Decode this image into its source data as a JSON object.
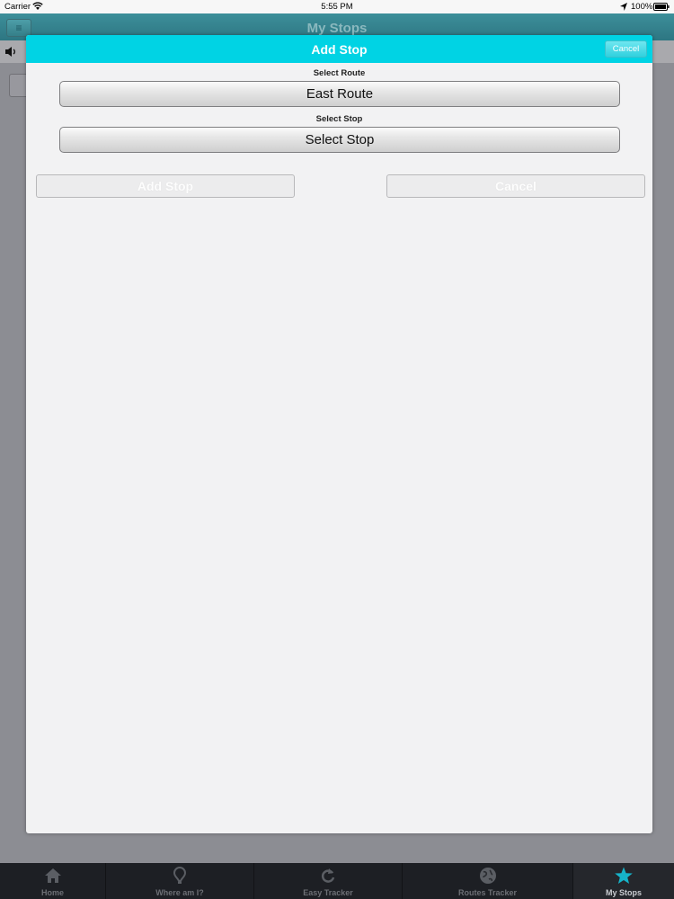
{
  "status_bar": {
    "carrier": "Carrier",
    "time": "5:55 PM",
    "battery": "100%"
  },
  "app": {
    "title": "My Stops",
    "menu_icon": "hamburger-menu-icon",
    "speaker_icon": "speaker-icon"
  },
  "modal": {
    "title": "Add Stop",
    "header_cancel": "Cancel",
    "route_label": "Select Route",
    "route_value": "East Route",
    "stop_label": "Select Stop",
    "stop_value": "Select Stop",
    "add_button": "Add Stop",
    "cancel_button": "Cancel",
    "header_color": "#00d3e4"
  },
  "tabs": [
    {
      "label": "Home",
      "icon": "home-icon",
      "active": false
    },
    {
      "label": "Where am I?",
      "icon": "location-pin-icon",
      "active": false
    },
    {
      "label": "Easy Tracker",
      "icon": "refresh-icon",
      "active": false
    },
    {
      "label": "Routes Tracker",
      "icon": "globe-icon",
      "active": false
    },
    {
      "label": "My Stops",
      "icon": "star-icon",
      "active": true
    }
  ]
}
